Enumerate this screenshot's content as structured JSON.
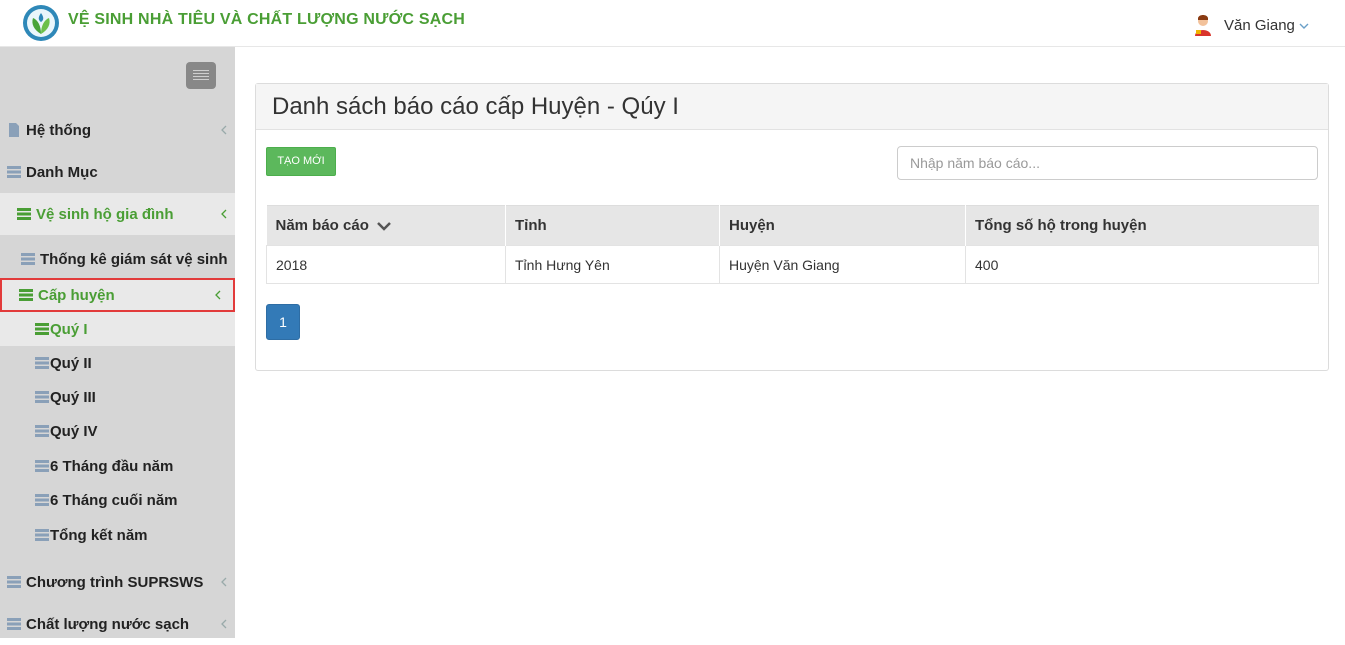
{
  "header": {
    "app_title": "VỆ SINH NHÀ TIÊU VÀ CHẤT LƯỢNG NƯỚC SẠCH",
    "user_name": "Văn Giang",
    "brand_color": "#4a9e35"
  },
  "sidebar": {
    "items": [
      {
        "label": "Hệ thống"
      },
      {
        "label": "Danh Mục"
      },
      {
        "label": "Vệ sinh hộ gia đình"
      },
      {
        "label": "Thống kê giám sát vệ sinh"
      },
      {
        "label": "Cấp huyện"
      },
      {
        "label": "Quý I"
      },
      {
        "label": "Quý II"
      },
      {
        "label": "Quý III"
      },
      {
        "label": "Quý IV"
      },
      {
        "label": "6 Tháng đầu năm"
      },
      {
        "label": "6 Tháng cuối năm"
      },
      {
        "label": "Tổng kết năm"
      },
      {
        "label": "Chương trình SUPRSWS"
      },
      {
        "label": "Chất lượng nước sạch"
      }
    ]
  },
  "main": {
    "title": "Danh sách báo cáo cấp Huyện - Qúy I",
    "create_button": "TẠO MỚI",
    "search_placeholder": "Nhập năm báo cáo...",
    "table": {
      "headers": [
        "Năm báo cáo",
        "Tỉnh",
        "Huyện",
        "Tổng số hộ trong huyện"
      ],
      "rows": [
        [
          "2018",
          "Tỉnh Hưng Yên",
          "Huyện Văn Giang",
          "400"
        ]
      ]
    },
    "pagination": {
      "current_page": "1"
    }
  }
}
